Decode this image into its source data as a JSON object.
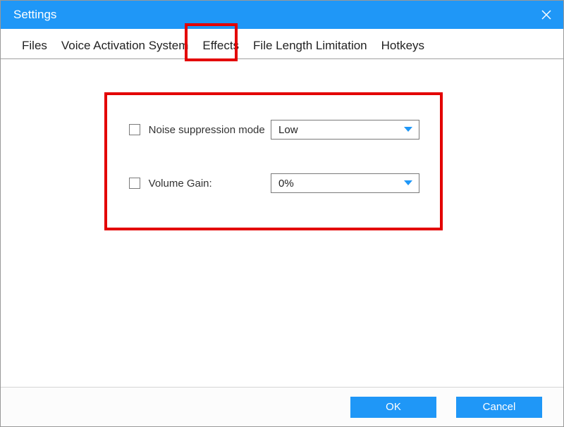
{
  "titlebar": {
    "title": "Settings"
  },
  "tabs": {
    "items": [
      {
        "label": "Files"
      },
      {
        "label": "Voice Activation System"
      },
      {
        "label": "Effects"
      },
      {
        "label": "File Length Limitation"
      },
      {
        "label": "Hotkeys"
      }
    ],
    "active_index": 2
  },
  "effects": {
    "noise_label": "Noise suppression mode",
    "noise_value": "Low",
    "volume_label": "Volume Gain:",
    "volume_value": "0%"
  },
  "footer": {
    "ok_label": "OK",
    "cancel_label": "Cancel"
  },
  "colors": {
    "accent": "#1f97f7",
    "highlight": "#e30000"
  }
}
